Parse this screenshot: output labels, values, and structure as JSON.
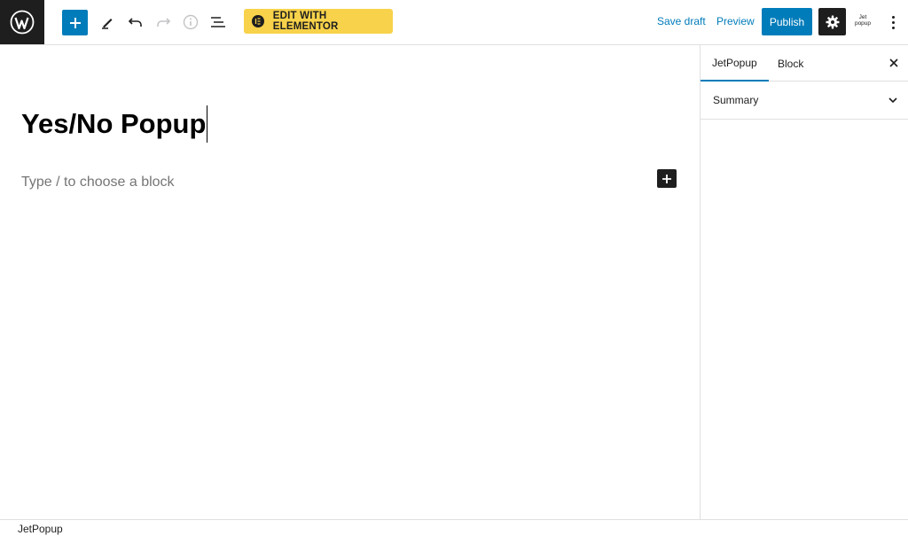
{
  "toolbar": {
    "wordpress_logo": "wordpress-logo-icon",
    "add_block_icon": "plus-icon",
    "tools_icon": "pencil-icon",
    "undo_icon": "undo-icon",
    "redo_icon": "redo-icon",
    "details_icon": "info-icon",
    "outline_icon": "list-view-icon",
    "elementor_label": "EDIT WITH ELEMENTOR",
    "save_draft_label": "Save draft",
    "preview_label": "Preview",
    "publish_label": "Publish",
    "settings_icon": "gear-icon",
    "plugin_logo_top": "Jet",
    "plugin_logo_bottom": "popup",
    "more_icon": "vertical-ellipsis-icon"
  },
  "editor": {
    "title": "Yes/No Popup",
    "block_placeholder": "Type / to choose a block"
  },
  "sidebar": {
    "tabs": [
      {
        "label": "JetPopup",
        "active": true
      },
      {
        "label": "Block",
        "active": false
      }
    ],
    "panels": [
      {
        "title": "Summary",
        "expanded": false
      }
    ]
  },
  "footer": {
    "breadcrumb": "JetPopup"
  },
  "colors": {
    "accent": "#007cba",
    "elementor_yellow": "#f8d24a",
    "dark": "#1e1e1e"
  }
}
